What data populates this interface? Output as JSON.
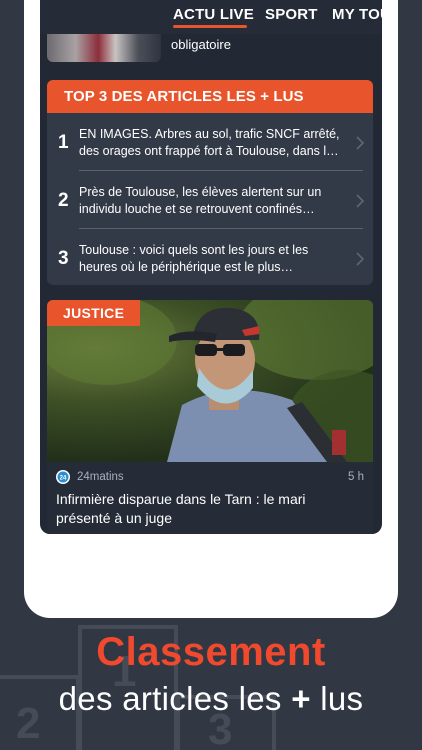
{
  "nav": {
    "tabs": [
      {
        "label": "ACTU LIVE",
        "active": true
      },
      {
        "label": "SPORT",
        "active": false
      },
      {
        "label": "MY TOU",
        "active": false
      }
    ]
  },
  "previous_article": {
    "text": "obligatoire"
  },
  "top3": {
    "title": "TOP 3 DES ARTICLES LES + LUS",
    "items": [
      {
        "rank": "1",
        "text": "EN IMAGES. Arbres au sol, trafic SNCF arrêté, des orages ont frappé fort à Toulouse, dans le Tarn,…"
      },
      {
        "rank": "2",
        "text": "Près de Toulouse, les élèves alertent sur un individu louche et se retrouvent confinés toute…"
      },
      {
        "rank": "3",
        "text": "Toulouse : voici quels sont les jours et les heures où le périphérique est le plus embouteillé"
      }
    ]
  },
  "article": {
    "category": "JUSTICE",
    "source": "24matins",
    "source_logo": "24",
    "time": "5 h",
    "title": "Infirmière disparue dans le Tarn : le mari présenté à un juge"
  },
  "caption": {
    "line1": "Classement",
    "line2_pre": "des articles les ",
    "line2_plus": "+",
    "line2_post": " lus"
  },
  "podium": {
    "numbers": [
      "2",
      "1",
      "3"
    ]
  },
  "colors": {
    "accent": "#e8542b",
    "background": "#323843",
    "card": "#333a47",
    "caption_red": "#f0492d"
  }
}
